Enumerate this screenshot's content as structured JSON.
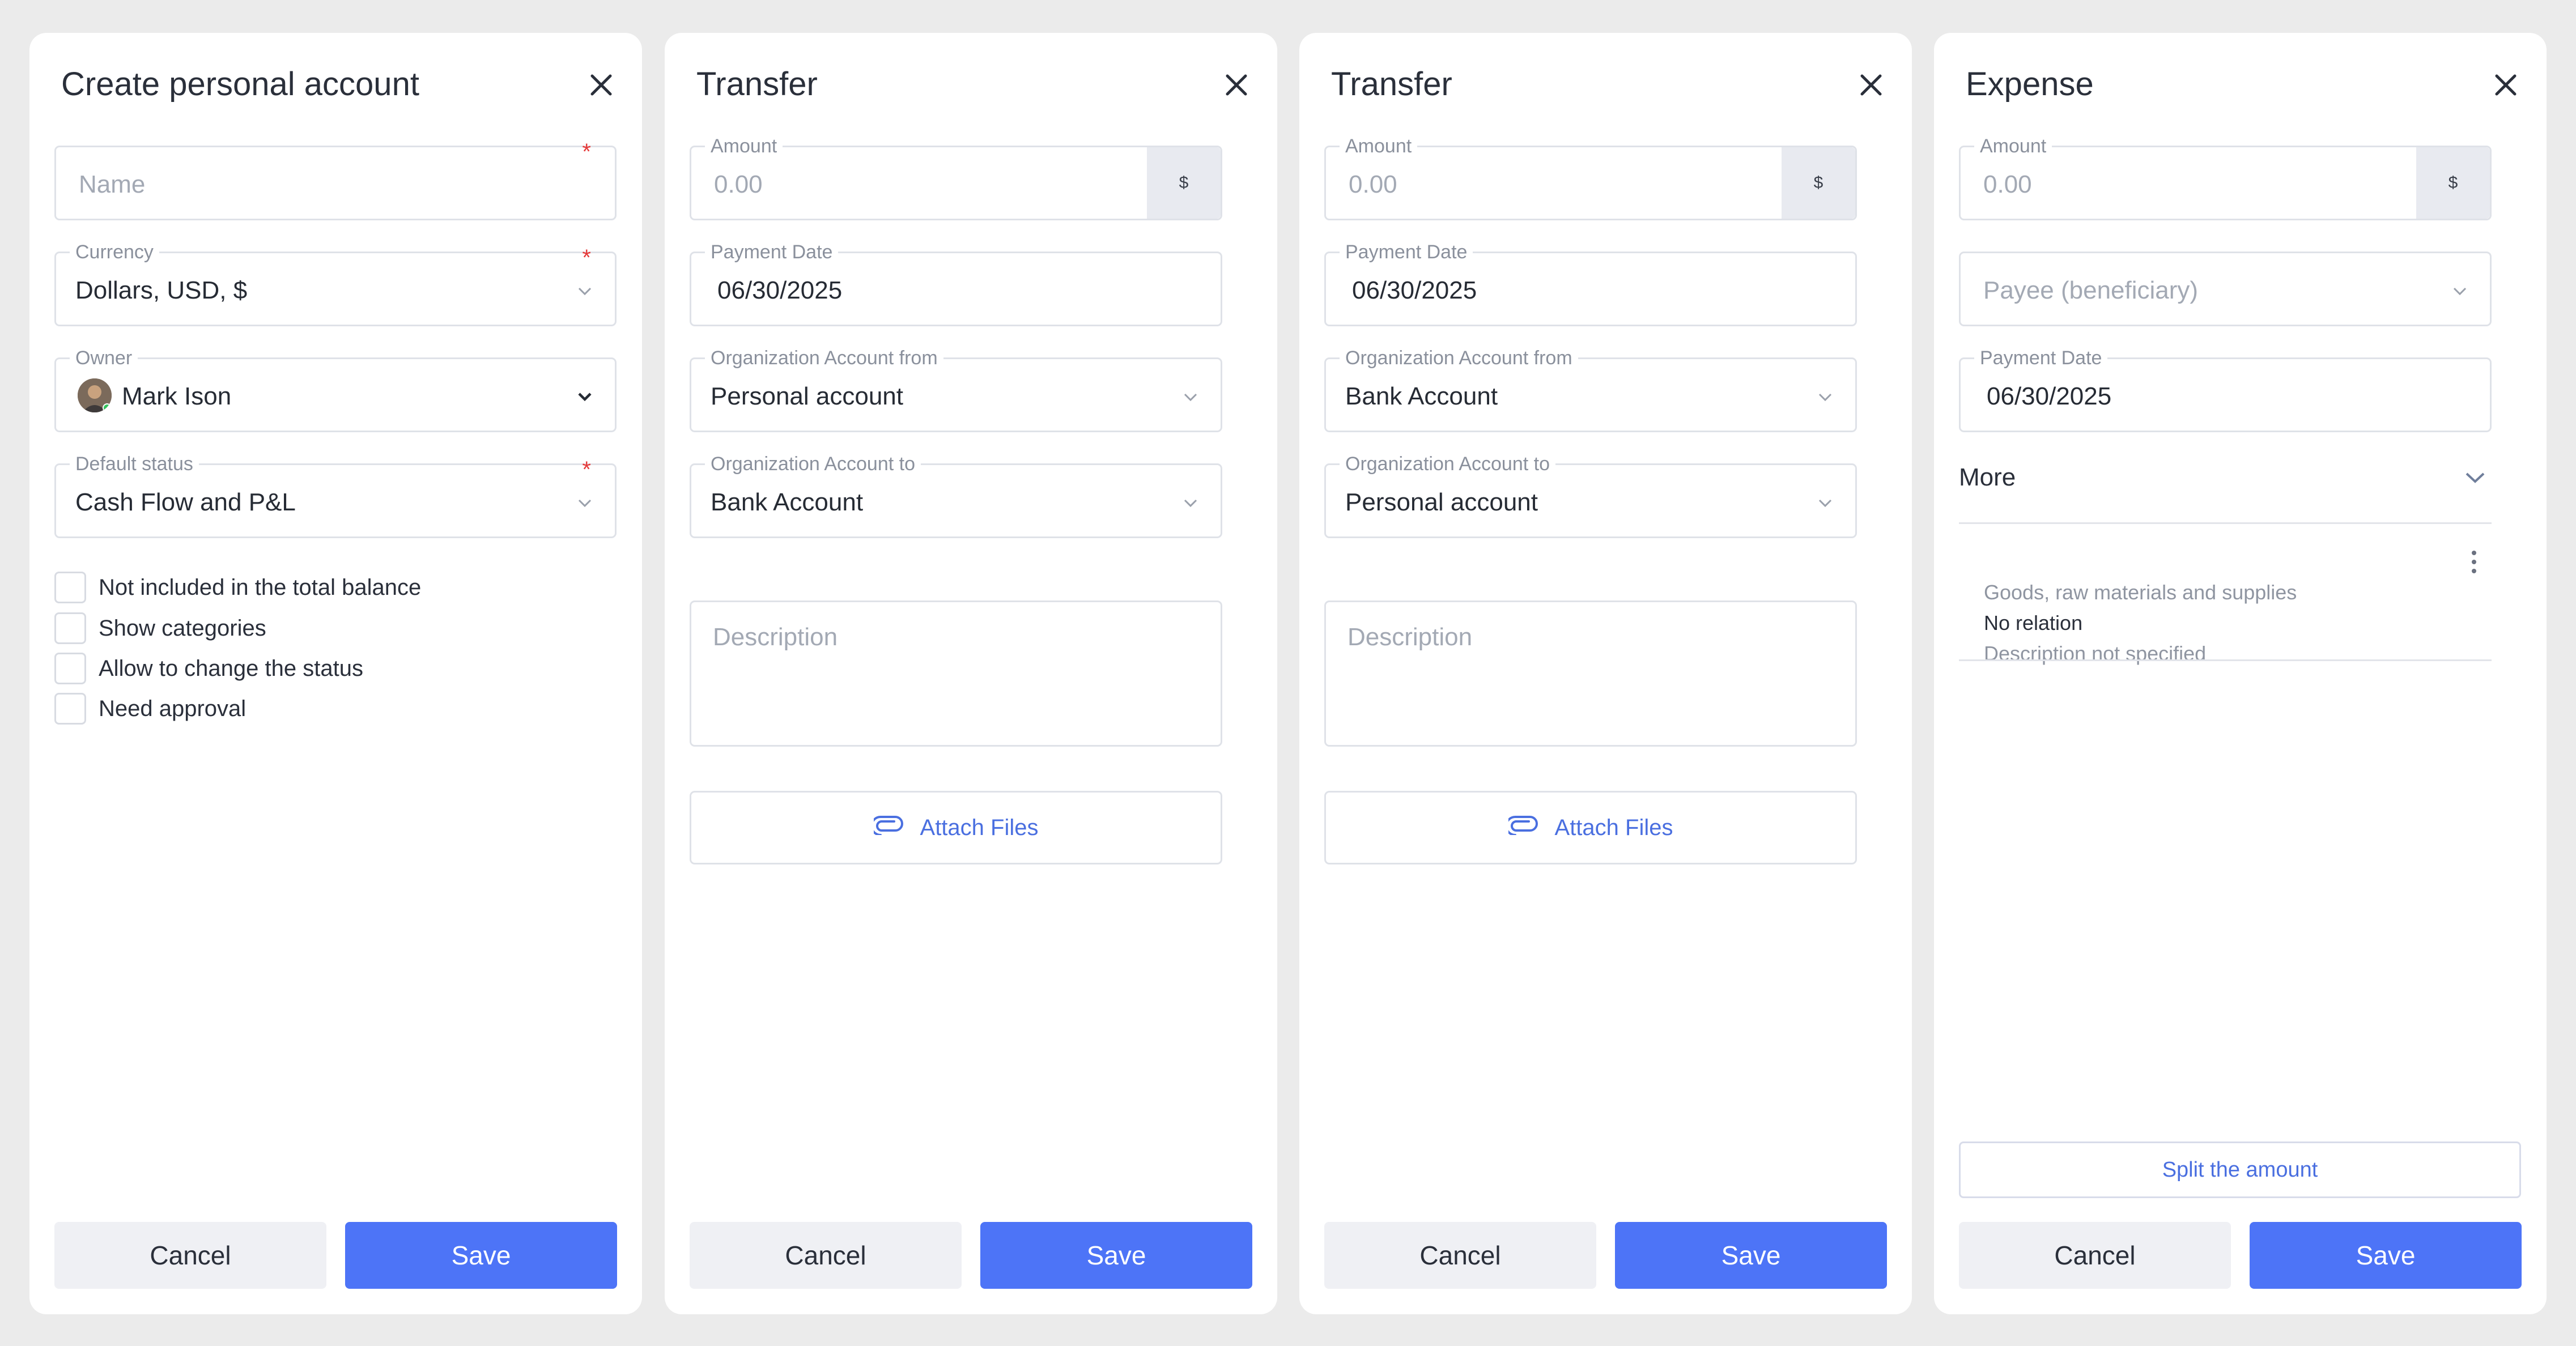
{
  "colors": {
    "primary": "#4d74f7",
    "link": "#4a6fe0",
    "required": "#e53a3a",
    "background": "#ebebeb"
  },
  "create_account": {
    "title": "Create personal account",
    "name_placeholder": "Name",
    "required_mark": "*",
    "currency": {
      "label": "Currency",
      "value": "Dollars, USD, $"
    },
    "owner": {
      "label": "Owner",
      "value": "Mark Ison"
    },
    "default_status": {
      "label": "Default status",
      "value": "Cash Flow and P&L"
    },
    "checkboxes": [
      {
        "label": "Not included in the total balance",
        "checked": false
      },
      {
        "label": "Show categories",
        "checked": false
      },
      {
        "label": "Allow to change the status",
        "checked": false
      },
      {
        "label": "Need approval",
        "checked": false
      }
    ],
    "cancel_label": "Cancel",
    "save_label": "Save"
  },
  "transfer_1": {
    "title": "Transfer",
    "amount": {
      "label": "Amount",
      "placeholder": "0.00",
      "currency_symbol": "$"
    },
    "payment_date": {
      "label": "Payment Date",
      "value": "06/30/2025"
    },
    "account_from": {
      "label": "Organization Account from",
      "value": "Personal account"
    },
    "account_to": {
      "label": "Organization Account to",
      "value": "Bank Account"
    },
    "description_placeholder": "Description",
    "attach_label": "Attach Files",
    "cancel_label": "Cancel",
    "save_label": "Save"
  },
  "transfer_2": {
    "title": "Transfer",
    "amount": {
      "label": "Amount",
      "placeholder": "0.00",
      "currency_symbol": "$"
    },
    "payment_date": {
      "label": "Payment Date",
      "value": "06/30/2025"
    },
    "account_from": {
      "label": "Organization Account from",
      "value": "Bank Account"
    },
    "account_to": {
      "label": "Organization Account to",
      "value": "Personal account"
    },
    "description_placeholder": "Description",
    "attach_label": "Attach Files",
    "cancel_label": "Cancel",
    "save_label": "Save"
  },
  "expense": {
    "title": "Expense",
    "amount": {
      "label": "Amount",
      "placeholder": "0.00",
      "currency_symbol": "$"
    },
    "payee_placeholder": "Payee (beneficiary)",
    "payment_date": {
      "label": "Payment Date",
      "value": "06/30/2025"
    },
    "more_label": "More",
    "split": {
      "category": "Goods, raw materials and supplies",
      "relation": "No relation",
      "description": "Description not specified"
    },
    "split_button_label": "Split the amount",
    "cancel_label": "Cancel",
    "save_label": "Save"
  }
}
